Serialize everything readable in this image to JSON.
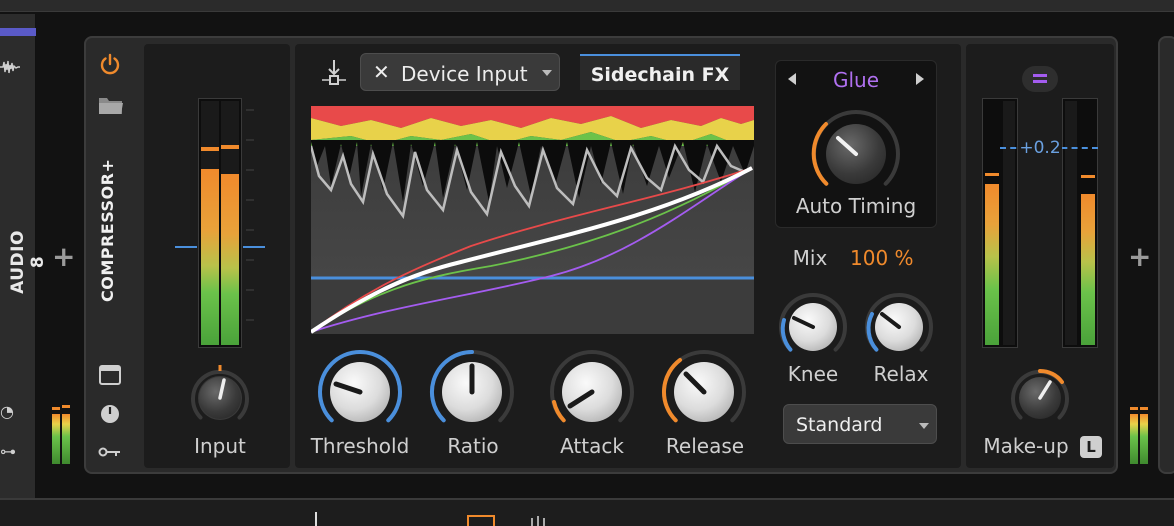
{
  "track": {
    "name": "AUDIO 8",
    "color": "#5a5ac8"
  },
  "device": {
    "name": "COMPRESSOR+",
    "accent": "#f08a2c"
  },
  "sidechain": {
    "source_label": "Device Input",
    "fx_tab_label": "Sidechain FX"
  },
  "input": {
    "label": "Input",
    "meter_left_level": 0.72,
    "meter_right_level": 0.7
  },
  "main_knobs": [
    {
      "id": "threshold",
      "label": "Threshold"
    },
    {
      "id": "ratio",
      "label": "Ratio"
    },
    {
      "id": "attack",
      "label": "Attack"
    },
    {
      "id": "release",
      "label": "Release"
    }
  ],
  "character": {
    "mode": "Glue",
    "timing_label": "Auto Timing"
  },
  "mix": {
    "label": "Mix",
    "value": "100 %"
  },
  "knee": {
    "label": "Knee"
  },
  "relax": {
    "label": "Relax"
  },
  "detector": {
    "selected": "Standard"
  },
  "output": {
    "makeup_label": "Make-up",
    "gain_readout": "+0.2",
    "lock_label": "L",
    "meter_left_level": 0.66,
    "meter_right_level": 0.62
  },
  "colors": {
    "orange": "#f08a2c",
    "blue": "#4a8fdc",
    "purple": "#a45cf0",
    "green": "#6bc24a",
    "yellow": "#e8d24a"
  }
}
